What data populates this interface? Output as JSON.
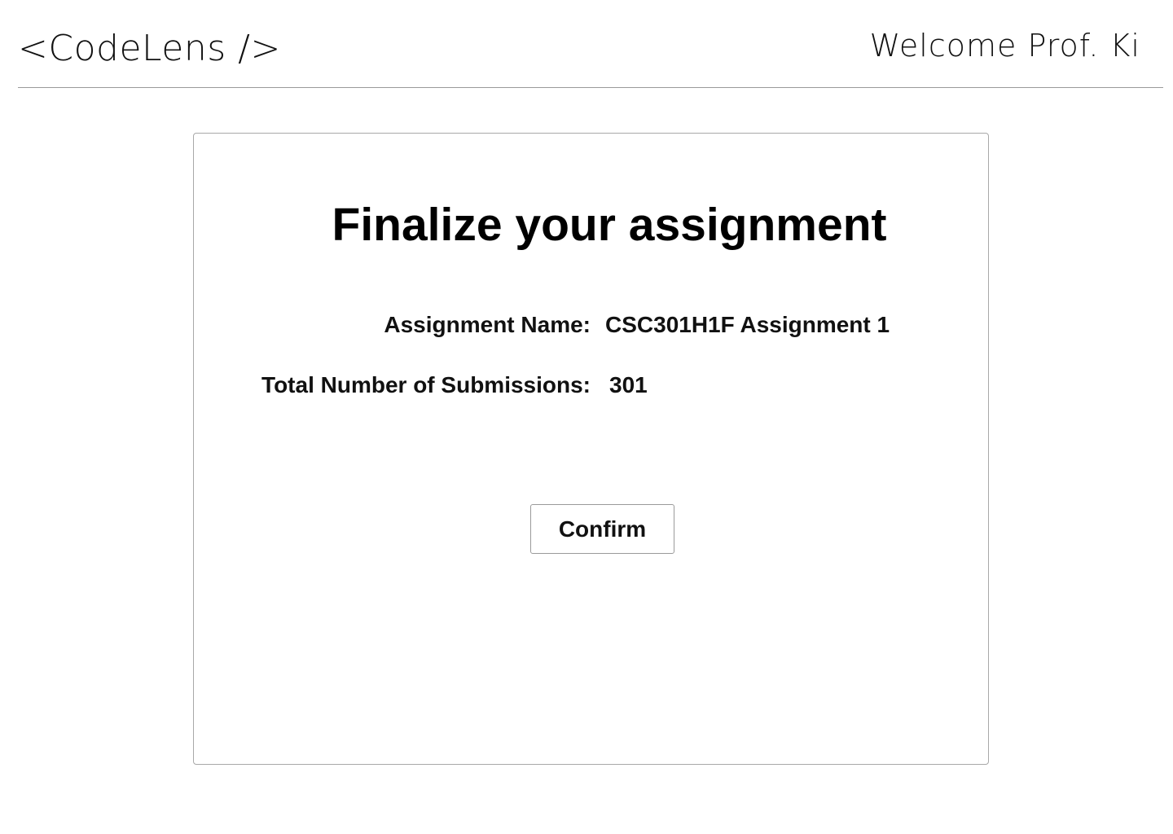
{
  "header": {
    "logo_text": "<CodeLens />",
    "welcome_text": "Welcome Prof. Ki"
  },
  "card": {
    "title": "Finalize your assignment",
    "assignment_name_label": "Assignment Name:",
    "assignment_name_value": "CSC301H1F Assignment 1",
    "submissions_label": "Total Number of Submissions:",
    "submissions_value": "301",
    "confirm_label": "Confirm"
  },
  "colors": {
    "background": "#ffffff",
    "text": "#111111",
    "border": "#a8a8a8"
  }
}
